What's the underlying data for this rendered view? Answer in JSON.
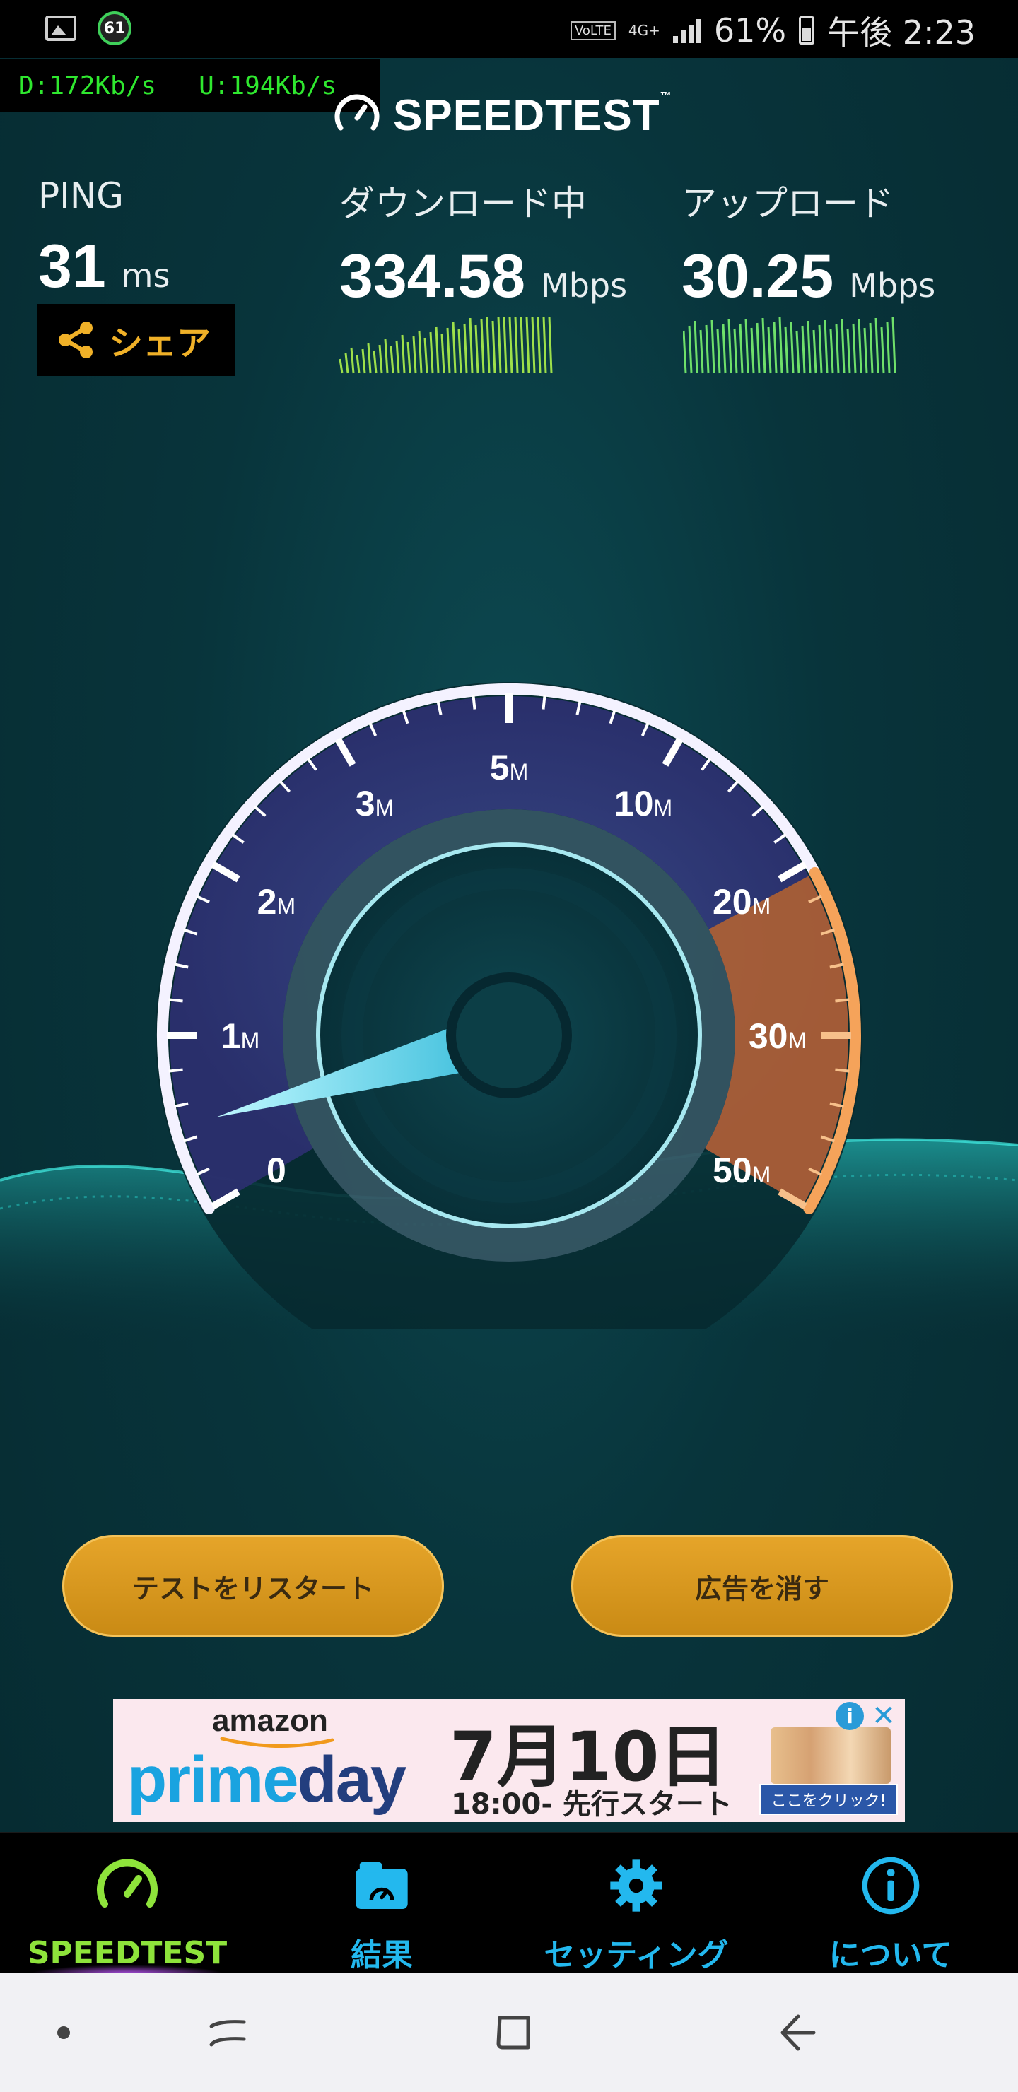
{
  "status_bar": {
    "notification_badge": "61",
    "volte": "VoLTE",
    "network": "4G+",
    "battery": "61%",
    "time": "午後 2:23"
  },
  "speed_overlay": {
    "download": "D:172Kb/s",
    "upload": "U:194Kb/s"
  },
  "header": {
    "logo_text": "SPEEDTEST",
    "trademark": "™"
  },
  "ping": {
    "label": "PING",
    "value": "31",
    "unit": "ms"
  },
  "download": {
    "label": "ダウンロード中",
    "value": "334.58",
    "unit": "Mbps"
  },
  "upload": {
    "label": "アップロード",
    "value": "30.25",
    "unit": "Mbps"
  },
  "share_button": {
    "label": "シェア"
  },
  "gauge": {
    "ticks": [
      {
        "num": "0",
        "unit": ""
      },
      {
        "num": "1",
        "unit": "M"
      },
      {
        "num": "2",
        "unit": "M"
      },
      {
        "num": "3",
        "unit": "M"
      },
      {
        "num": "5",
        "unit": "M"
      },
      {
        "num": "10",
        "unit": "M"
      },
      {
        "num": "20",
        "unit": "M"
      },
      {
        "num": "30",
        "unit": "M"
      },
      {
        "num": "50",
        "unit": "M"
      }
    ],
    "needle_value": 0.06
  },
  "buttons": {
    "restart": "テストをリスタート",
    "remove_ads": "広告を消す"
  },
  "ad": {
    "brand": "amazon",
    "prime": "prime",
    "day": "day",
    "date": "7月10日",
    "time": "18:00- 先行スタート",
    "cta": "ここをクリック!",
    "info": "i",
    "close": "✕"
  },
  "bottom_nav": {
    "items": [
      {
        "label": "SPEEDTEST",
        "icon": "speedometer-icon",
        "active": true
      },
      {
        "label": "結果",
        "icon": "results-folder-icon",
        "active": false
      },
      {
        "label": "セッティング",
        "icon": "gear-icon",
        "active": false
      },
      {
        "label": "について",
        "icon": "info-icon",
        "active": false
      }
    ]
  },
  "colors": {
    "accent_green": "#8ee33b",
    "accent_blue": "#23b8ee",
    "button_gold": "#e0a024",
    "overlay_green": "#2fe82f"
  }
}
